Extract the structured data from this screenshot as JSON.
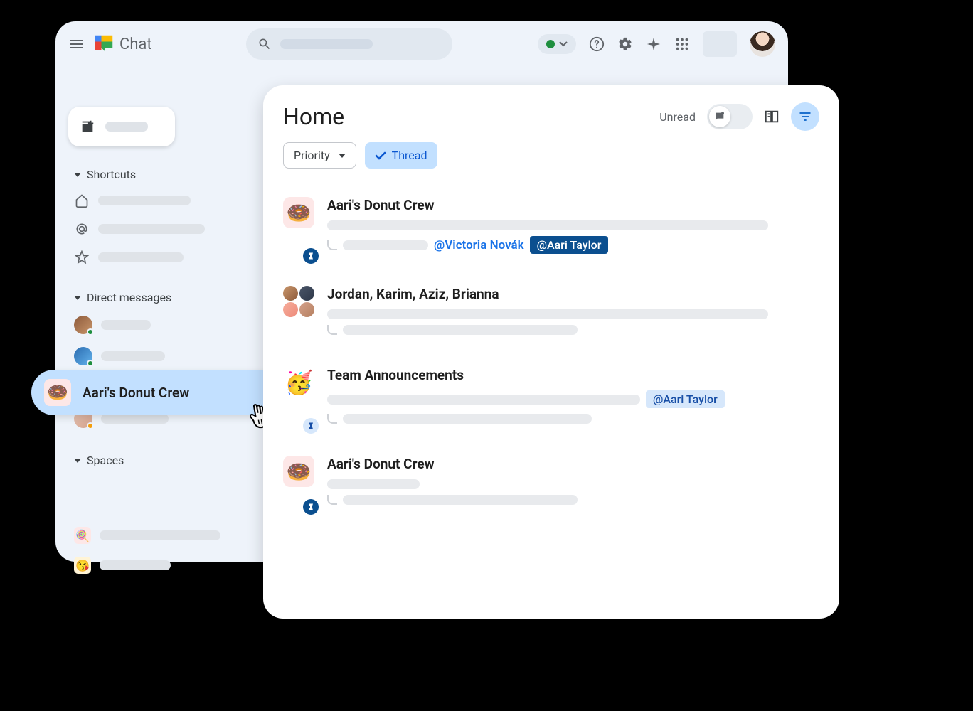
{
  "app": {
    "name": "Chat"
  },
  "sidebar": {
    "shortcuts_title": "Shortcuts",
    "dm_title": "Direct messages",
    "spaces_title": "Spaces",
    "selected_space": "Aari's Donut Crew"
  },
  "main": {
    "title": "Home",
    "unread_label": "Unread",
    "chip_priority": "Priority",
    "chip_thread": "Thread",
    "threads": [
      {
        "title": "Aari's Donut Crew",
        "mention_link": "@Victoria Novák",
        "mention_chip": "@Aari Taylor"
      },
      {
        "title": "Jordan, Karim, Aziz, Brianna"
      },
      {
        "title": "Team Announcements",
        "mention_chip_light": "@Aari Taylor"
      },
      {
        "title": "Aari's Donut Crew"
      }
    ]
  }
}
